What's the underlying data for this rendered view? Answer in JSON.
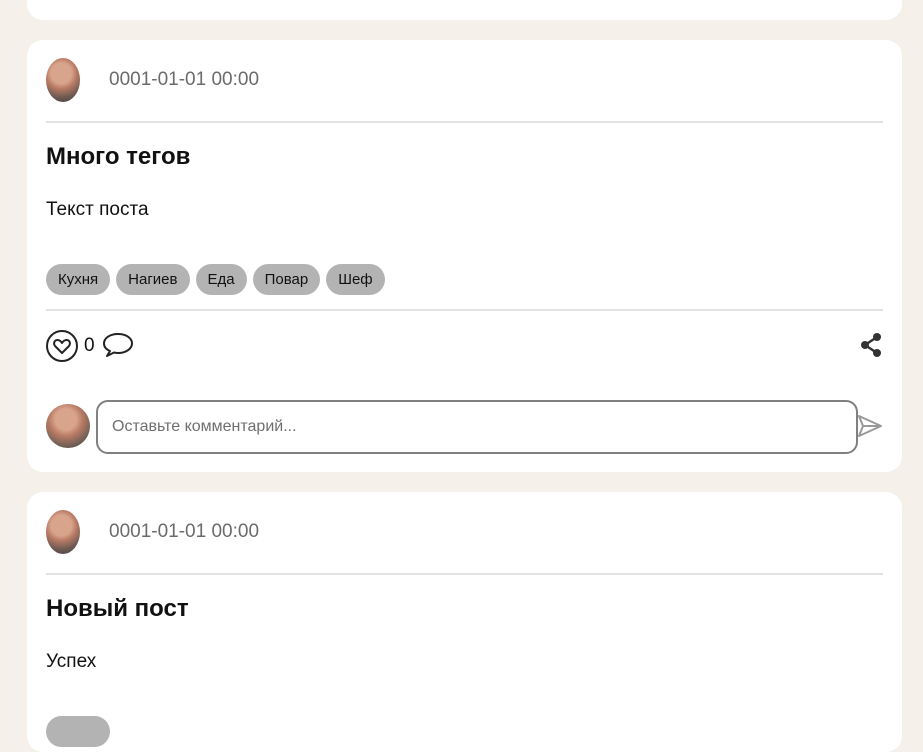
{
  "posts": [
    {
      "date": "0001-01-01 00:00",
      "title": "Много тегов",
      "text": "Текст поста",
      "tags": [
        "Кухня",
        "Нагиев",
        "Еда",
        "Повар",
        "Шеф"
      ],
      "likes": "0",
      "comment_placeholder": "Оставьте комментарий..."
    },
    {
      "date": "0001-01-01 00:00",
      "title": "Новый пост",
      "text": "Успех"
    }
  ],
  "icons": {
    "like": "heart-icon",
    "comment": "speech-bubble-icon",
    "share": "share-icon",
    "send": "send-icon"
  }
}
